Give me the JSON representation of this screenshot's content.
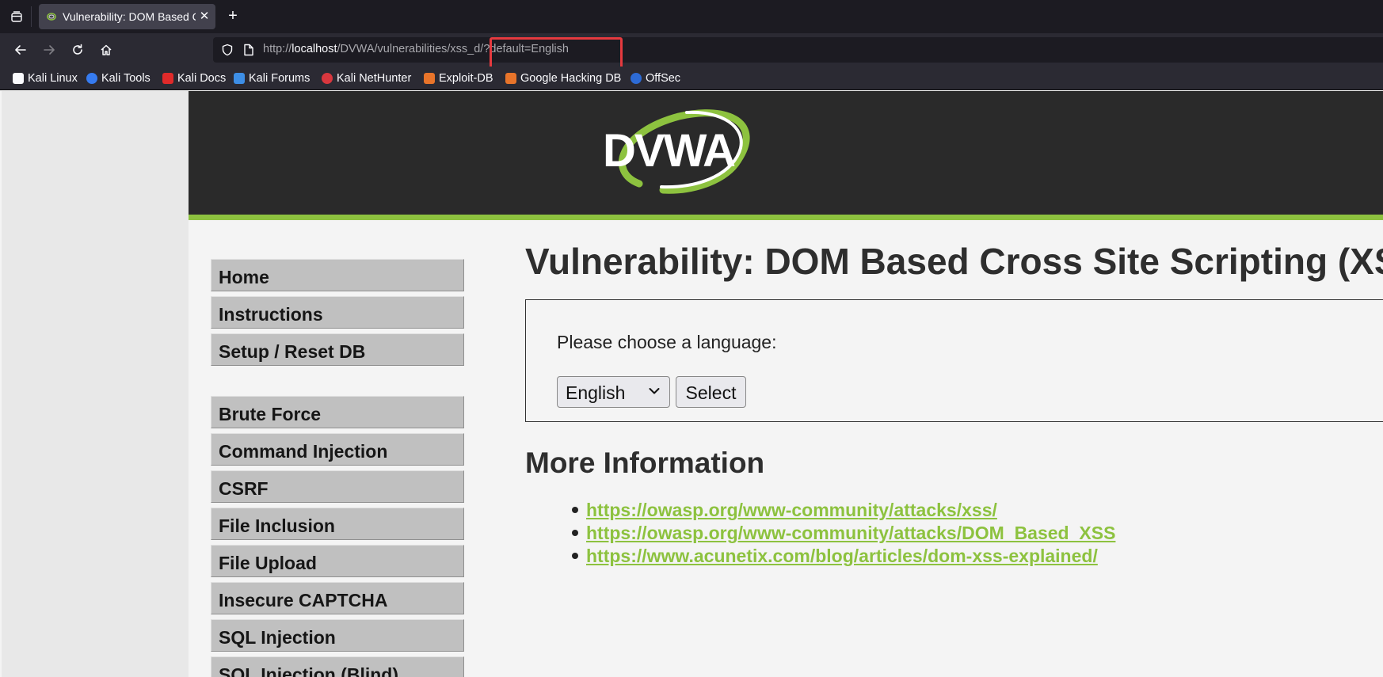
{
  "browser": {
    "tab_title": "Vulnerability: DOM Based Cross Site Scripting (XSS)",
    "tab_close_glyph": "✕",
    "new_tab_glyph": "+",
    "url": {
      "scheme": "http://",
      "host": "localhost",
      "path_before": "/DVWA/vulnerabilities/xss_",
      "path_highlighted": "d/?default=English"
    },
    "bookmarks": [
      {
        "label": "Kali Linux",
        "icon": "kali-dragon-icon",
        "color": "#1c1b22"
      },
      {
        "label": "Kali Tools",
        "icon": "kali-tools-icon",
        "color": "#367bf0"
      },
      {
        "label": "Kali Docs",
        "icon": "kali-docs-icon",
        "color": "#e02a2a"
      },
      {
        "label": "Kali Forums",
        "icon": "kali-forums-icon",
        "color": "#3d8ee6"
      },
      {
        "label": "Kali NetHunter",
        "icon": "nethunter-icon",
        "color": "#d8373e"
      },
      {
        "label": "Exploit-DB",
        "icon": "exploit-db-icon",
        "color": "#e8742a"
      },
      {
        "label": "Google Hacking DB",
        "icon": "ghdb-icon",
        "color": "#e8742a"
      },
      {
        "label": "OffSec",
        "icon": "offsec-icon",
        "color": "#2d6bd6"
      }
    ]
  },
  "colors": {
    "accent_green": "#8dc23f",
    "url_highlight_red": "#e53a3f"
  },
  "dvwa": {
    "logo_text": "DVWA",
    "menu_group_1": [
      "Home",
      "Instructions",
      "Setup / Reset DB"
    ],
    "menu_group_2": [
      "Brute Force",
      "Command Injection",
      "CSRF",
      "File Inclusion",
      "File Upload",
      "Insecure CAPTCHA",
      "SQL Injection",
      "SQL Injection (Blind)"
    ],
    "title": "Vulnerability: DOM Based Cross Site Scripting (XSS)",
    "language_prompt": "Please choose a language:",
    "language_selected": "English",
    "select_button": "Select",
    "more_info_heading": "More Information",
    "links": [
      "https://owasp.org/www-community/attacks/xss/",
      "https://owasp.org/www-community/attacks/DOM_Based_XSS",
      "https://www.acunetix.com/blog/articles/dom-xss-explained/"
    ]
  }
}
